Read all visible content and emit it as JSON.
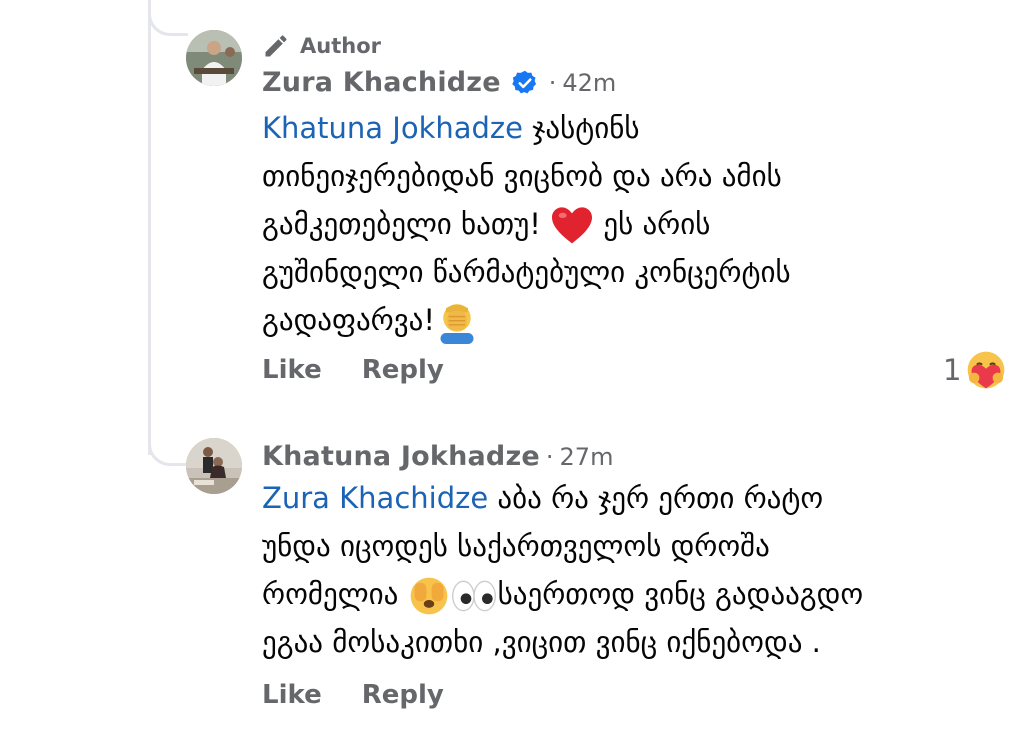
{
  "comments": [
    {
      "author_badge": "Author",
      "name": "Zura Khachidze",
      "verified": true,
      "time": "42m",
      "mention": "Khatuna Jokhadze",
      "text_line1": " ჯასტინს",
      "text_line2": "თინეიჯერებიდან ვიცნობ და არა ამის",
      "text_line3a": "გამკეთებელი ხათუ! ",
      "text_line3b": " ეს არის",
      "text_line4": "გუშინდელი წარმატებული კონცერტის",
      "text_line5": "გადაფარვა!",
      "like_label": "Like",
      "reply_label": "Reply",
      "reaction_count": "1",
      "reaction_icon": "care-reaction-icon"
    },
    {
      "name": "Khatuna Jokhadze",
      "time": "27m",
      "mention": "Zura Khachidze",
      "text_line1": " აბა რა ჯერ ერთი რატო",
      "text_line2": "უნდა იცოდეს საქართველოს დროშა",
      "text_line3a": "რომელია ",
      "text_line3b": "საერთოდ ვინც გადააგდო",
      "text_line4": "ეგაა მოსაკითხი ,ვიცით ვინც იქნებოდა .",
      "like_label": "Like",
      "reply_label": "Reply"
    }
  ],
  "colors": {
    "mention": "#1b63b5",
    "meta_gray": "#65676b",
    "verified_blue": "#1877f2",
    "thread_line": "#e4e6eb"
  }
}
